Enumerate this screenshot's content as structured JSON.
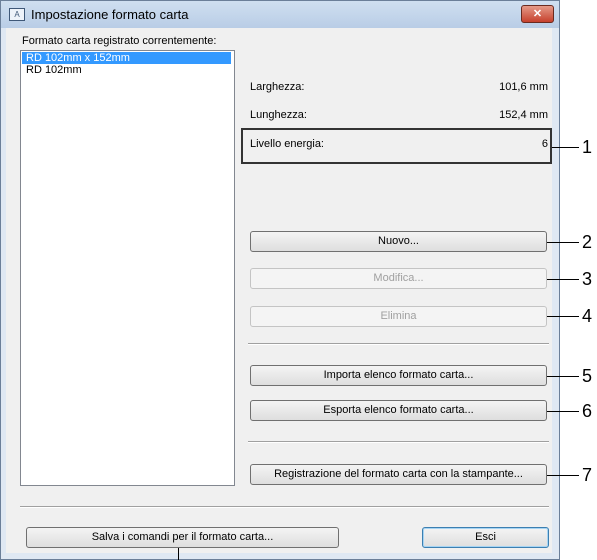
{
  "window": {
    "title": "Impostazione formato carta",
    "close_label": "✕",
    "icon_label": "A"
  },
  "list": {
    "label": "Formato carta registrato correntemente:",
    "items": [
      "RD 102mm x 152mm",
      "RD 102mm"
    ],
    "selected_index": 0
  },
  "details": {
    "width_label": "Larghezza:",
    "width_value": "101,6 mm",
    "length_label": "Lunghezza:",
    "length_value": "152,4 mm",
    "energy_label": "Livello energia:",
    "energy_value": "6"
  },
  "buttons": {
    "new": "Nuovo...",
    "edit": "Modifica...",
    "delete": "Elimina",
    "import": "Importa elenco formato carta...",
    "export": "Esporta elenco formato carta...",
    "register": "Registrazione del formato carta con la stampante...",
    "save_commands": "Salva i comandi per il formato carta...",
    "exit": "Esci"
  },
  "callouts": [
    "1",
    "2",
    "3",
    "4",
    "5",
    "6",
    "7"
  ]
}
